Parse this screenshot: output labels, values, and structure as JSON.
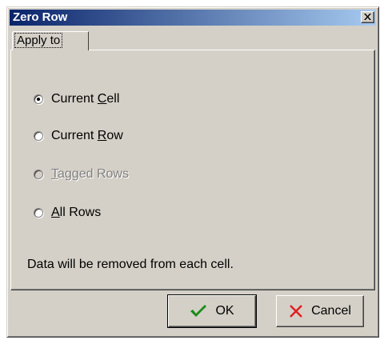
{
  "window": {
    "title": "Zero Row",
    "close_glyph": "✕"
  },
  "tab": {
    "label": "Apply to"
  },
  "options": [
    {
      "id": "current-cell",
      "pre": "Current ",
      "accel": "C",
      "post": "ell",
      "checked": true,
      "disabled": false
    },
    {
      "id": "current-row",
      "pre": "Current ",
      "accel": "R",
      "post": "ow",
      "checked": false,
      "disabled": false
    },
    {
      "id": "tagged-rows",
      "pre": "",
      "accel": "T",
      "post": "agged Rows",
      "checked": false,
      "disabled": true
    },
    {
      "id": "all-rows",
      "pre": "",
      "accel": "A",
      "post": "ll Rows",
      "checked": false,
      "disabled": false
    }
  ],
  "info": "Data will be removed from each cell.",
  "buttons": {
    "ok": {
      "label": "OK",
      "icon": "checkmark-icon",
      "color": "#1a8c1a"
    },
    "cancel": {
      "label": "Cancel",
      "icon": "x-icon",
      "color": "#e02020"
    }
  }
}
